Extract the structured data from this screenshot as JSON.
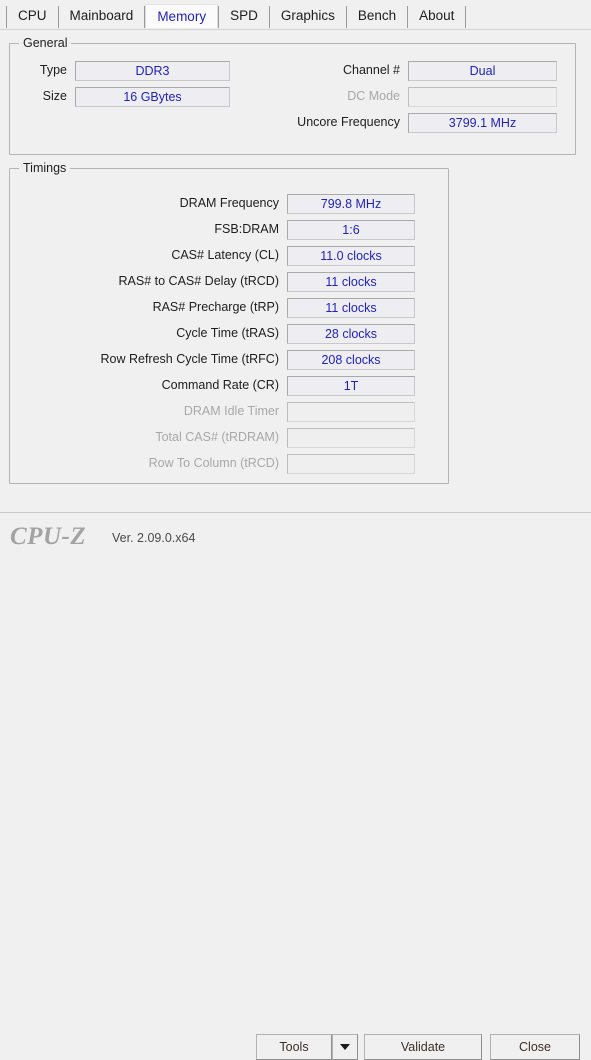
{
  "window": {
    "app_name": "CPU-Z",
    "version": "Ver. 2.09.0.x64"
  },
  "tabs": [
    {
      "label": "CPU",
      "active": false
    },
    {
      "label": "Mainboard",
      "active": false
    },
    {
      "label": "Memory",
      "active": true
    },
    {
      "label": "SPD",
      "active": false
    },
    {
      "label": "Graphics",
      "active": false
    },
    {
      "label": "Bench",
      "active": false
    },
    {
      "label": "About",
      "active": false
    }
  ],
  "general": {
    "legend": "General",
    "left": [
      {
        "label": "Type",
        "value": "DDR3",
        "disabled": false
      },
      {
        "label": "Size",
        "value": "16 GBytes",
        "disabled": false
      }
    ],
    "right": [
      {
        "label": "Channel #",
        "value": "Dual",
        "disabled": false
      },
      {
        "label": "DC Mode",
        "value": "",
        "disabled": true
      },
      {
        "label": "Uncore Frequency",
        "value": "3799.1 MHz",
        "disabled": false
      }
    ]
  },
  "timings": {
    "legend": "Timings",
    "rows": [
      {
        "label": "DRAM Frequency",
        "value": "799.8 MHz",
        "disabled": false
      },
      {
        "label": "FSB:DRAM",
        "value": "1:6",
        "disabled": false
      },
      {
        "label": "CAS# Latency (CL)",
        "value": "11.0 clocks",
        "disabled": false
      },
      {
        "label": "RAS# to CAS# Delay (tRCD)",
        "value": "11 clocks",
        "disabled": false
      },
      {
        "label": "RAS# Precharge (tRP)",
        "value": "11 clocks",
        "disabled": false
      },
      {
        "label": "Cycle Time (tRAS)",
        "value": "28 clocks",
        "disabled": false
      },
      {
        "label": "Row Refresh Cycle Time (tRFC)",
        "value": "208 clocks",
        "disabled": false
      },
      {
        "label": "Command Rate (CR)",
        "value": "1T",
        "disabled": false
      },
      {
        "label": "DRAM Idle Timer",
        "value": "",
        "disabled": true
      },
      {
        "label": "Total CAS# (tRDRAM)",
        "value": "",
        "disabled": true
      },
      {
        "label": "Row To Column (tRCD)",
        "value": "",
        "disabled": true
      }
    ]
  },
  "footer": {
    "tools_label": "Tools",
    "tools_dropdown_icon": "chevron-down-icon",
    "validate_label": "Validate",
    "close_label": "Close"
  },
  "colors": {
    "value_text": "#2222bb",
    "active_tab_text": "#2222bb",
    "disabled_text": "#a8a8a8",
    "window_background": "#f0f0f0",
    "field_background": "#eeeef2"
  }
}
